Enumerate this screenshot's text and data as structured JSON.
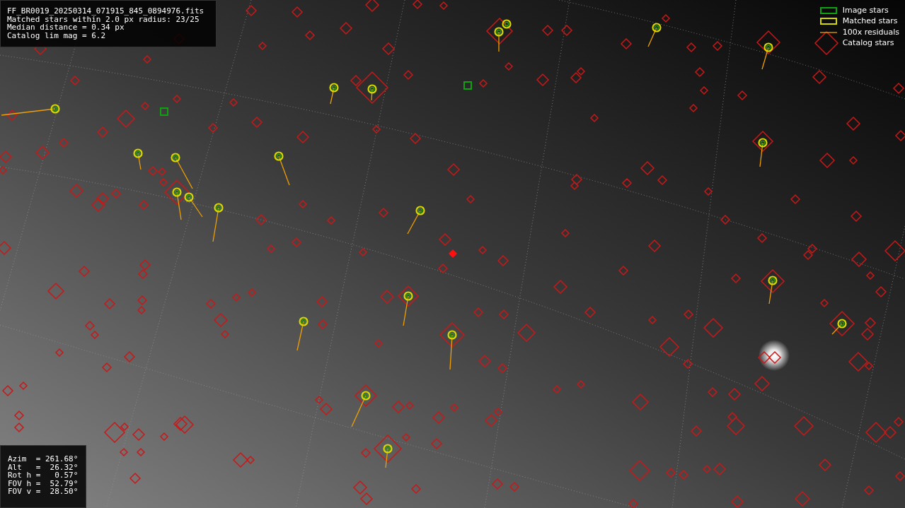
{
  "info_panel": {
    "lines": [
      "FF_BR0019_20250314_071915_845_0894976.fits",
      "Matched stars within 2.0 px radius: 23/25",
      "Median distance = 0.34 px",
      "Catalog lim mag = 6.2"
    ]
  },
  "legend": {
    "items": [
      {
        "kind": "image",
        "label": "Image stars"
      },
      {
        "kind": "matched",
        "label": "Matched stars"
      },
      {
        "kind": "residual",
        "label": "100x residuals"
      },
      {
        "kind": "catalog",
        "label": "Catalog stars"
      }
    ]
  },
  "pointing_panel": {
    "lines": [
      "Azim  = 261.68°",
      "Alt   =  26.32°",
      "Rot h =   0.57°",
      "FOV h =  52.79°",
      "FOV v =  28.50°"
    ]
  }
}
